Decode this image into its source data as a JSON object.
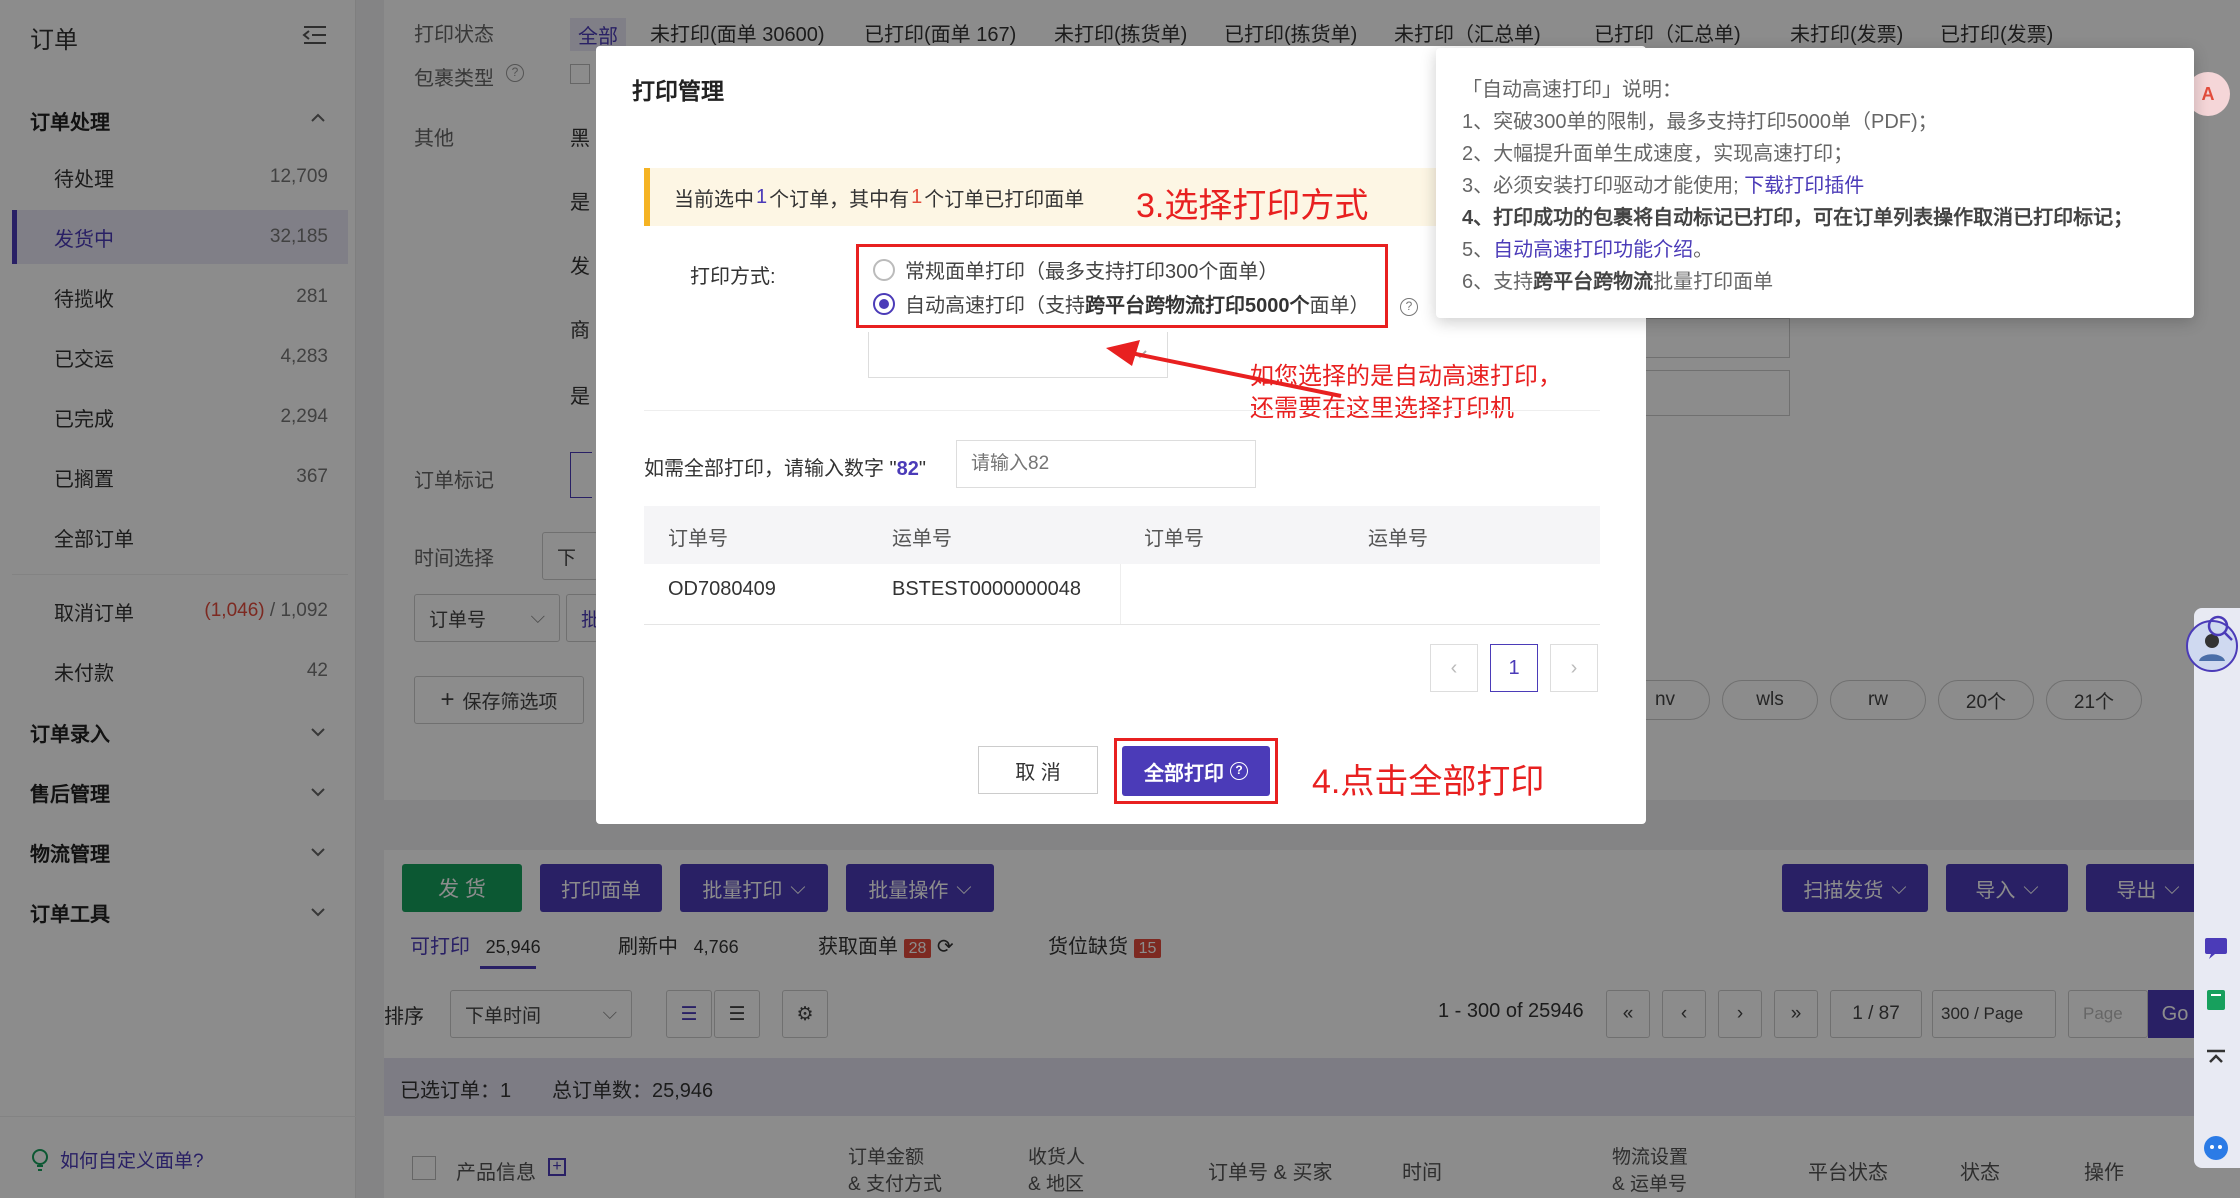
{
  "sidebar": {
    "title": "订单",
    "groups": {
      "order_processing": "订单处理",
      "order_entry": "订单录入",
      "after_sales": "售后管理",
      "logistics": "物流管理",
      "order_tools": "订单工具"
    },
    "items": [
      {
        "label": "待处理",
        "count": "12,709"
      },
      {
        "label": "发货中",
        "count": "32,185"
      },
      {
        "label": "待揽收",
        "count": "281"
      },
      {
        "label": "已交运",
        "count": "4,283"
      },
      {
        "label": "已完成",
        "count": "2,294"
      },
      {
        "label": "已搁置",
        "count": "367"
      },
      {
        "label": "全部订单",
        "count": ""
      }
    ],
    "cancel": {
      "label": "取消订单",
      "count_red": "(1,046)",
      "count": " / 1,092"
    },
    "unpaid": {
      "label": "未付款",
      "count": "42"
    },
    "help": "如何自定义面单?"
  },
  "filters": {
    "print_status_label": "打印状态",
    "tabs": [
      "全部",
      "未打印(面单 30600)",
      "已打印(面单 167)",
      "未打印(拣货单)",
      "已打印(拣货单)",
      "未打印（汇总单)",
      "已打印（汇总单)",
      "未打印(发票)",
      "已打印(发票)"
    ],
    "package_type_label": "包裹类型",
    "other_label": "其他",
    "other_partial": [
      "黑",
      "是",
      "发",
      "商",
      "是"
    ],
    "order_mark_label": "订单标记",
    "time_label": "时间选择",
    "time_partial": "下",
    "order_no_select": "订单号",
    "batch_partial": "批",
    "save_filter": "保存筛选项",
    "pills": [
      "nv",
      "wls",
      "rw",
      "20个",
      "21个"
    ]
  },
  "toolbar": {
    "ship": "发 货",
    "print_label": "打印面单",
    "batch_print": "批量打印",
    "batch_ops": "批量操作",
    "scan_ship": "扫描发货",
    "import": "导入",
    "export": "导出"
  },
  "subtabs": [
    {
      "label": "可打印",
      "count": "25,946"
    },
    {
      "label": "刷新中",
      "count": "4,766"
    },
    {
      "label": "获取面单",
      "count": "28"
    },
    {
      "label": "货位缺货",
      "count": "15"
    }
  ],
  "sort": {
    "label": "排序",
    "value": "下单时间",
    "range": "1 - 300 of 25946",
    "page": "1 / 87",
    "per_page": "300 / Page",
    "page_placeholder": "Page",
    "go": "Go"
  },
  "summary": {
    "selected": "已选订单：1",
    "total": "总订单数：25,946"
  },
  "table_header": [
    "产品信息",
    "订单金额\n& 支付方式",
    "收货人\n& 地区",
    "订单号 & 买家",
    "时间",
    "物流设置\n& 运单号",
    "平台状态",
    "状态",
    "操作"
  ],
  "modal": {
    "title": "打印管理",
    "notice_pre": "当前选中",
    "notice_num1": "1",
    "notice_mid": "个订单，其中有",
    "notice_num2": "1",
    "notice_post": "个订单已打印面单",
    "step3": "3.选择打印方式",
    "print_mode_label": "打印方式:",
    "option_regular": "常规面单打印（最多支持打印300个面单）",
    "option_fast_pre": "自动高速打印（支持",
    "option_fast_bold": "跨平台跨物流打印5000个",
    "option_fast_post": "面单）",
    "arrow_note_1": "如您选择的是自动高速打印，",
    "arrow_note_2": "还需要在这里选择打印机",
    "confirm_label_pre": "如需全部打印，请输入数字 \"",
    "confirm_label_num": "82",
    "confirm_label_post": "\"",
    "confirm_placeholder": "请输入82",
    "table_headers": [
      "订单号",
      "运单号",
      "订单号",
      "运单号"
    ],
    "rows": [
      {
        "order": "OD7080409",
        "waybill": "BSTEST0000000048"
      }
    ],
    "page": "1",
    "cancel": "取 消",
    "print_all": "全部打印",
    "step4": "4.点击全部打印"
  },
  "tooltip": {
    "title": "「自动高速打印」说明：",
    "l1": "1、突破300单的限制，最多支持打印5000单（PDF)；",
    "l2": "2、大幅提升面单生成速度，实现高速打印；",
    "l3_pre": "3、必须安装打印驱动才能使用; ",
    "l3_link": "下载打印插件",
    "l4": "4、打印成功的包裹将自动标记已打印，可在订单列表操作取消已打印标记；",
    "l5_pre": "5、",
    "l5_link": "自动高速打印功能介绍",
    "l5_post": "。",
    "l6_pre": "6、支持",
    "l6_bold": "跨平台跨物流",
    "l6_post": "批量打印面单"
  },
  "colors": {
    "accent": "#4b3bb8",
    "green": "#17a05d",
    "red": "#e82020",
    "warn": "#f5b323"
  }
}
